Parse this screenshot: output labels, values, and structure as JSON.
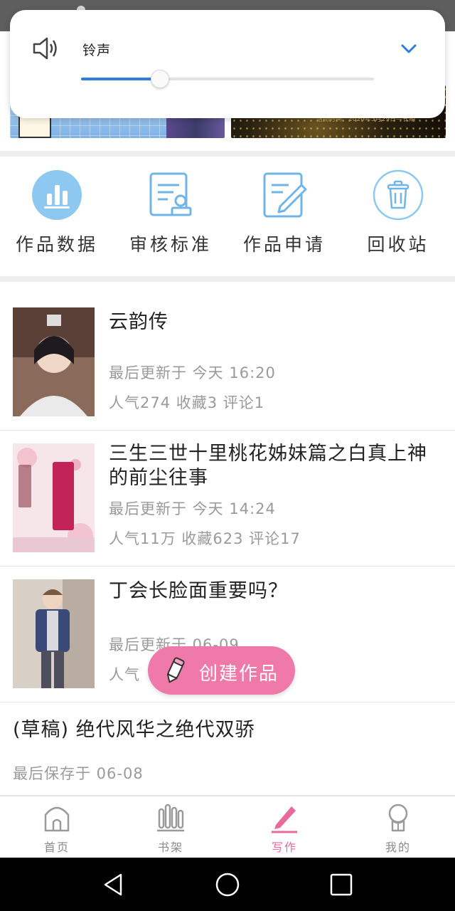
{
  "volume_panel": {
    "label": "铃声",
    "level": 0.27,
    "speaker_icon": "speaker-icon",
    "expand_icon": "chevron-down-icon",
    "accent": "#2a7ee0"
  },
  "banners": {
    "second_caption": "活动时间：2020年5月29日—长期"
  },
  "quick_actions": [
    {
      "label": "作品数据",
      "icon": "bar-chart-icon"
    },
    {
      "label": "审核标准",
      "icon": "review-document-icon"
    },
    {
      "label": "作品申请",
      "icon": "edit-document-icon"
    },
    {
      "label": "回收站",
      "icon": "trash-icon"
    }
  ],
  "works": [
    {
      "title": "云韵传",
      "updated": "最后更新于 今天 16:20",
      "stats": "人气274 收藏3 评论1"
    },
    {
      "title": "三生三世十里桃花姊妹篇之白真上神的前尘往事",
      "updated": "最后更新于 今天 14:24",
      "stats": "人气11万 收藏623 评论17"
    },
    {
      "title": "丁会长脸面重要吗？",
      "updated": "最后更新于 06-09",
      "stats": "人气"
    }
  ],
  "draft": {
    "title": "(草稿) 绝代风华之绝代双骄",
    "saved": "最后保存于 06-08"
  },
  "fab": {
    "label": "创建作品",
    "icon": "pencil-icon",
    "color": "#ef79a9"
  },
  "tabs": [
    {
      "label": "首页",
      "icon": "home-icon"
    },
    {
      "label": "书架",
      "icon": "bookshelf-icon"
    },
    {
      "label": "写作",
      "icon": "pen-icon",
      "active": true
    },
    {
      "label": "我的",
      "icon": "profile-icon"
    }
  ],
  "colors": {
    "accent_blue": "#5aa9e6",
    "accent_pink": "#e8699c"
  }
}
